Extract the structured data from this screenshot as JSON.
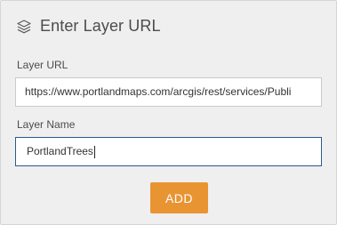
{
  "header": {
    "icon": "layers-icon",
    "title": "Enter Layer URL"
  },
  "layer_url": {
    "label": "Layer URL",
    "value": "https://www.portlandmaps.com/arcgis/rest/services/Publi"
  },
  "layer_name": {
    "label": "Layer Name",
    "value": "PortlandTrees"
  },
  "add_button": {
    "label": "ADD"
  },
  "colors": {
    "accent": "#e99433",
    "focus_border": "#2c5a8c",
    "panel_bg": "#efefef",
    "text": "#4c4c4c"
  }
}
